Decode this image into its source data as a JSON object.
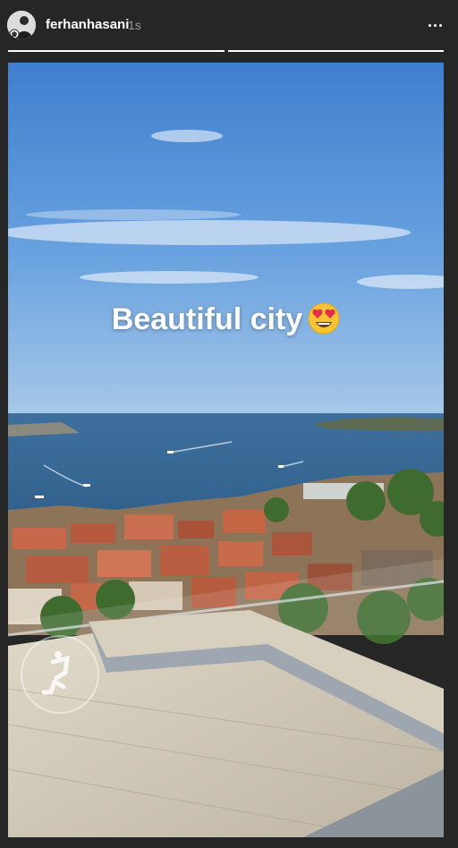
{
  "header": {
    "username": "ferhanhasani",
    "timestamp": "1s",
    "avatar_icon": "user-avatar",
    "more_icon": "more-horizontal-icon"
  },
  "progress": {
    "segments": [
      1.0,
      1.0
    ]
  },
  "story": {
    "caption": "Beautiful city",
    "caption_emoji": "heart-eyes-face-emoji",
    "sticker_icon": "boomerang-sticker-icon"
  }
}
